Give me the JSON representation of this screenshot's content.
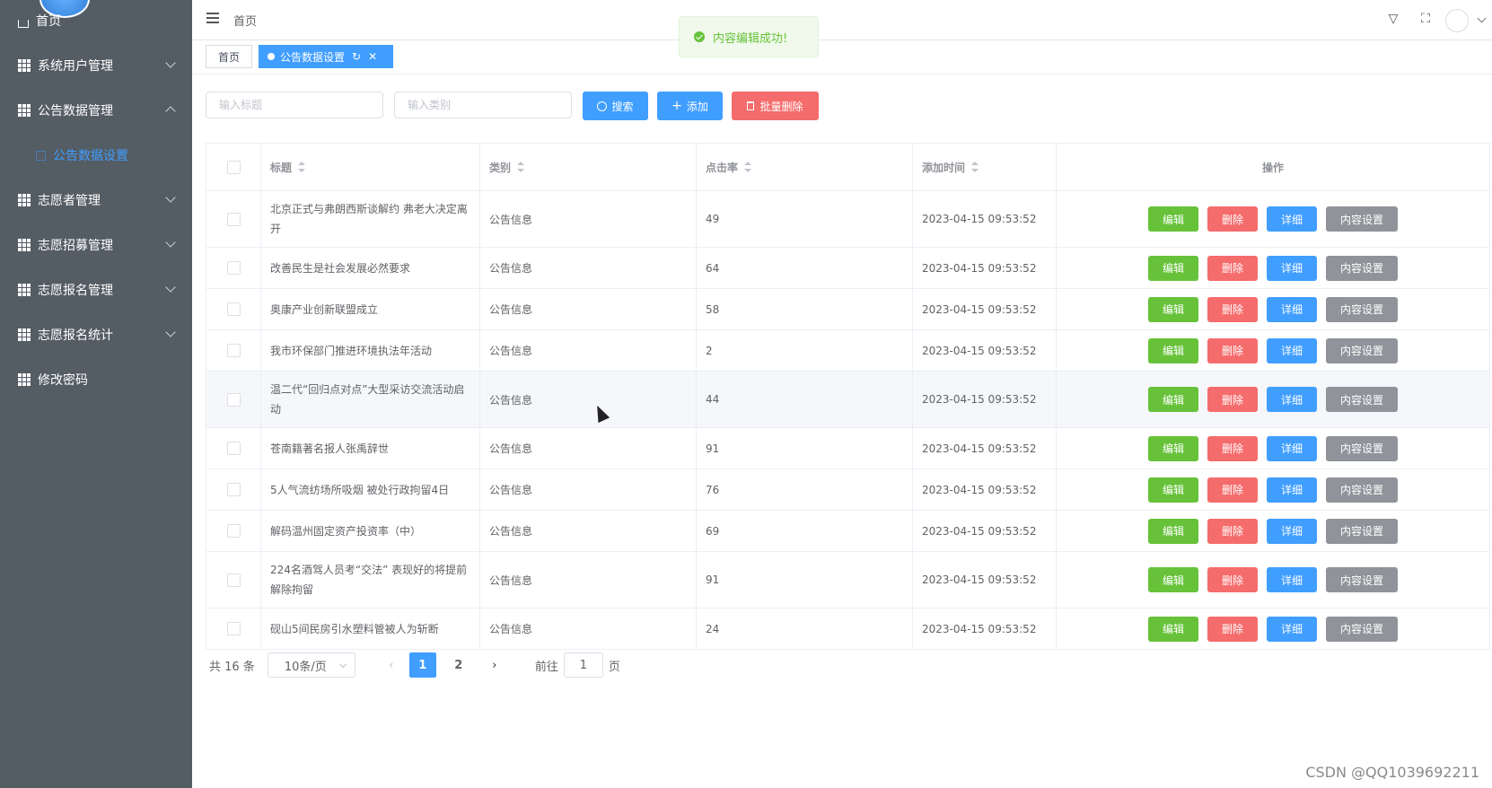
{
  "sidebar": {
    "items": [
      {
        "label": "首页"
      },
      {
        "label": "系统用户管理"
      },
      {
        "label": "公告数据管理"
      },
      {
        "label": "公告数据设置"
      },
      {
        "label": "志愿者管理"
      },
      {
        "label": "志愿招募管理"
      },
      {
        "label": "志愿报名管理"
      },
      {
        "label": "志愿报名统计"
      },
      {
        "label": "修改密码"
      }
    ]
  },
  "header": {
    "breadcrumb": "首页"
  },
  "toast": {
    "message": "内容编辑成功!"
  },
  "tabs": [
    {
      "label": "首页"
    },
    {
      "label": "公告数据设置"
    }
  ],
  "search": {
    "title_placeholder": "输入标题",
    "category_placeholder": "输入类别",
    "search_label": "搜索",
    "add_label": "添加",
    "bulk_delete_label": "批量删除"
  },
  "table": {
    "columns": [
      "标题",
      "类别",
      "点击率",
      "添加时间",
      "操作"
    ],
    "rows": [
      {
        "title": "北京正式与弗朗西斯谈解约 弗老大决定离开",
        "category": "公告信息",
        "clicks": "49",
        "time": "2023-04-15 09:53:52"
      },
      {
        "title": "改善民生是社会发展必然要求",
        "category": "公告信息",
        "clicks": "64",
        "time": "2023-04-15 09:53:52"
      },
      {
        "title": "奥康产业创新联盟成立",
        "category": "公告信息",
        "clicks": "58",
        "time": "2023-04-15 09:53:52"
      },
      {
        "title": "我市环保部门推进环境执法年活动",
        "category": "公告信息",
        "clicks": "2",
        "time": "2023-04-15 09:53:52"
      },
      {
        "title": "温二代“回归点对点”大型采访交流活动启动",
        "category": "公告信息",
        "clicks": "44",
        "time": "2023-04-15 09:53:52"
      },
      {
        "title": "苍南籍著名报人张禹辞世",
        "category": "公告信息",
        "clicks": "91",
        "time": "2023-04-15 09:53:52"
      },
      {
        "title": "5人气流纺场所吸烟 被处行政拘留4日",
        "category": "公告信息",
        "clicks": "76",
        "time": "2023-04-15 09:53:52"
      },
      {
        "title": "解码温州固定资产投资率（中）",
        "category": "公告信息",
        "clicks": "69",
        "time": "2023-04-15 09:53:52"
      },
      {
        "title": "224名酒驾人员考“交法” 表现好的将提前解除拘留",
        "category": "公告信息",
        "clicks": "91",
        "time": "2023-04-15 09:53:52"
      },
      {
        "title": "砚山5间民房引水塑料管被人为斩断",
        "category": "公告信息",
        "clicks": "24",
        "time": "2023-04-15 09:53:52"
      }
    ],
    "actions": {
      "edit": "编辑",
      "delete": "删除",
      "detail": "详细",
      "content": "内容设置"
    }
  },
  "pagination": {
    "total": "共 16 条",
    "page_size": "10条/页",
    "pages": [
      "1",
      "2"
    ],
    "current": "1",
    "goto_label": "前往",
    "goto_value": "1",
    "page_suffix": "页"
  },
  "watermark": "CSDN @QQ1039692211",
  "colors": {
    "sidebar": "#545c64",
    "primary": "#409eff",
    "success": "#67c23a",
    "danger": "#f56c6c",
    "info": "#909399"
  }
}
